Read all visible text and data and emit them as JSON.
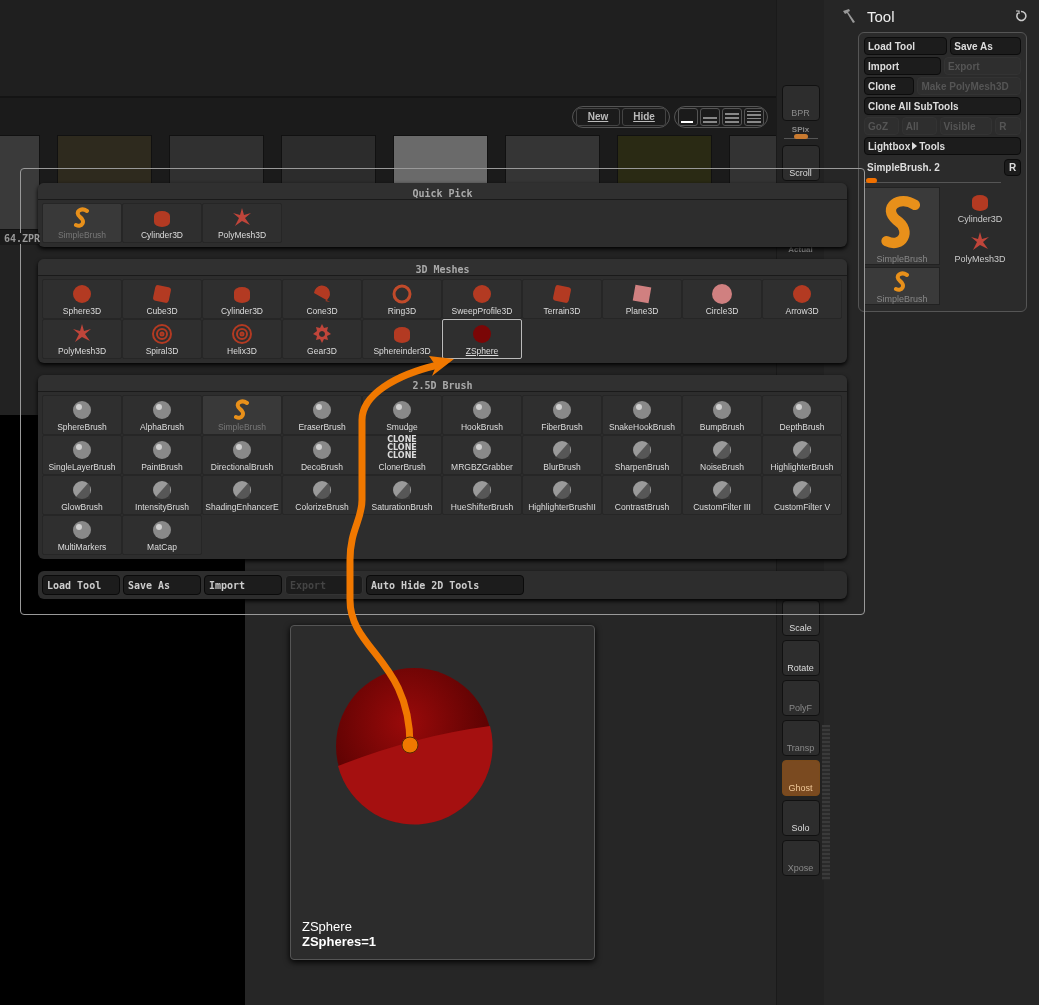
{
  "lightbox": {
    "file_label": "64.ZPR",
    "buttons": [
      {
        "label": "New"
      },
      {
        "label": "Hide"
      }
    ],
    "view_modes": [
      {
        "selected": true
      },
      {
        "selected": false
      },
      {
        "selected": false
      },
      {
        "selected": false
      }
    ]
  },
  "popup": {
    "sections": [
      {
        "title": "Quick Pick",
        "items": [
          {
            "label": "SimpleBrush",
            "kind": "swirl",
            "disabled": true,
            "selected": false
          },
          {
            "label": "Cylinder3D",
            "kind": "cylinder",
            "disabled": false,
            "selected": false
          },
          {
            "label": "PolyMesh3D",
            "kind": "star",
            "disabled": false,
            "selected": false
          }
        ]
      },
      {
        "title": "3D Meshes",
        "items": [
          {
            "label": "Sphere3D",
            "kind": "sphere",
            "disabled": false,
            "selected": false
          },
          {
            "label": "Cube3D",
            "kind": "cube",
            "disabled": false,
            "selected": false
          },
          {
            "label": "Cylinder3D",
            "kind": "cylinder",
            "disabled": false,
            "selected": false
          },
          {
            "label": "Cone3D",
            "kind": "cone",
            "disabled": false,
            "selected": false
          },
          {
            "label": "Ring3D",
            "kind": "ring",
            "disabled": false,
            "selected": false
          },
          {
            "label": "SweepProfile3D",
            "kind": "sphere",
            "disabled": false,
            "selected": false
          },
          {
            "label": "Terrain3D",
            "kind": "cube",
            "disabled": false,
            "selected": false
          },
          {
            "label": "Plane3D",
            "kind": "plate",
            "disabled": false,
            "selected": false
          },
          {
            "label": "Circle3D",
            "kind": "disc",
            "disabled": false,
            "selected": false
          },
          {
            "label": "Arrow3D",
            "kind": "sphere",
            "disabled": false,
            "selected": false
          },
          {
            "label": "PolyMesh3D",
            "kind": "star",
            "disabled": false,
            "selected": false
          },
          {
            "label": "Spiral3D",
            "kind": "spiral",
            "disabled": false,
            "selected": false
          },
          {
            "label": "Helix3D",
            "kind": "spiral",
            "disabled": false,
            "selected": false
          },
          {
            "label": "Gear3D",
            "kind": "gear",
            "disabled": false,
            "selected": false
          },
          {
            "label": "Sphereinder3D",
            "kind": "cylinder",
            "disabled": false,
            "selected": false
          },
          {
            "label": "ZSphere",
            "kind": "zsphere",
            "disabled": false,
            "selected": true
          }
        ]
      },
      {
        "title": "2.5D Brush",
        "items": [
          {
            "label": "SphereBrush",
            "kind": "ball",
            "disabled": false,
            "selected": false
          },
          {
            "label": "AlphaBrush",
            "kind": "ball",
            "disabled": false,
            "selected": false
          },
          {
            "label": "SimpleBrush",
            "kind": "swirl",
            "disabled": true,
            "selected": false
          },
          {
            "label": "EraserBrush",
            "kind": "ball",
            "disabled": false,
            "selected": false
          },
          {
            "label": "Smudge",
            "kind": "ball",
            "disabled": false,
            "selected": false
          },
          {
            "label": "HookBrush",
            "kind": "ball",
            "disabled": false,
            "selected": false
          },
          {
            "label": "FiberBrush",
            "kind": "ball",
            "disabled": false,
            "selected": false
          },
          {
            "label": "SnakeHookBrush",
            "kind": "ball",
            "disabled": false,
            "selected": false
          },
          {
            "label": "BumpBrush",
            "kind": "ball",
            "disabled": false,
            "selected": false
          },
          {
            "label": "DepthBrush",
            "kind": "ball",
            "disabled": false,
            "selected": false
          },
          {
            "label": "SingleLayerBrush",
            "kind": "ball",
            "disabled": false,
            "selected": false
          },
          {
            "label": "PaintBrush",
            "kind": "ball",
            "disabled": false,
            "selected": false
          },
          {
            "label": "DirectionalBrush",
            "kind": "ball",
            "disabled": false,
            "selected": false
          },
          {
            "label": "DecoBrush",
            "kind": "ball",
            "disabled": false,
            "selected": false
          },
          {
            "label": "ClonerBrush",
            "kind": "text-stack",
            "icon_text": [
              "CLONE",
              "CLONE",
              "CLONE"
            ],
            "disabled": false,
            "selected": false
          },
          {
            "label": "MRGBZGrabber",
            "kind": "ball",
            "disabled": false,
            "selected": false
          },
          {
            "label": "BlurBrush",
            "kind": "split-ball",
            "disabled": false,
            "selected": false
          },
          {
            "label": "SharpenBrush",
            "kind": "split-ball",
            "disabled": false,
            "selected": false
          },
          {
            "label": "NoiseBrush",
            "kind": "split-ball",
            "disabled": false,
            "selected": false
          },
          {
            "label": "HighlighterBrush",
            "kind": "split-ball",
            "disabled": false,
            "selected": false
          },
          {
            "label": "GlowBrush",
            "kind": "split-ball",
            "disabled": false,
            "selected": false
          },
          {
            "label": "IntensityBrush",
            "kind": "split-ball",
            "disabled": false,
            "selected": false
          },
          {
            "label": "ShadingEnhancerE",
            "kind": "split-ball",
            "disabled": false,
            "selected": false
          },
          {
            "label": "ColorizeBrush",
            "kind": "split-ball",
            "disabled": false,
            "selected": false
          },
          {
            "label": "SaturationBrush",
            "kind": "split-ball",
            "disabled": false,
            "selected": false
          },
          {
            "label": "HueShifterBrush",
            "kind": "split-ball",
            "disabled": false,
            "selected": false
          },
          {
            "label": "HighlighterBrushII",
            "kind": "split-ball",
            "disabled": false,
            "selected": false
          },
          {
            "label": "ContrastBrush",
            "kind": "split-ball",
            "disabled": false,
            "selected": false
          },
          {
            "label": "CustomFilter  III",
            "kind": "split-ball",
            "disabled": false,
            "selected": false
          },
          {
            "label": "CustomFilter  V",
            "kind": "split-ball",
            "disabled": false,
            "selected": false
          },
          {
            "label": "MultiMarkers",
            "kind": "ball",
            "disabled": false,
            "selected": false
          },
          {
            "label": "MatCap",
            "kind": "ball",
            "disabled": false,
            "selected": false
          }
        ]
      }
    ],
    "buttons": [
      {
        "label": "Load Tool",
        "disabled": false
      },
      {
        "label": "Save As",
        "disabled": false
      },
      {
        "label": "Import",
        "disabled": false
      },
      {
        "label": "Export",
        "disabled": true
      },
      {
        "label": "Auto Hide 2D Tools",
        "disabled": false
      }
    ]
  },
  "preview": {
    "title": "ZSphere",
    "info": "ZSpheres=1"
  },
  "shelf": {
    "top": [
      {
        "label": "BPR",
        "kind": "button",
        "disabled": true
      },
      {
        "label": "SPix",
        "kind": "slider",
        "level": 0.5
      },
      {
        "label": "Scroll",
        "kind": "button",
        "disabled": false
      },
      {
        "label": "Actual",
        "kind": "label"
      }
    ],
    "bottom": [
      {
        "label": "Scale",
        "disabled": false,
        "active": false
      },
      {
        "label": "Rotate",
        "disabled": false,
        "active": false
      },
      {
        "label": "PolyF",
        "disabled": true,
        "active": false
      },
      {
        "label": "Transp",
        "disabled": true,
        "active": false
      },
      {
        "label": "Ghost",
        "disabled": true,
        "active": true
      },
      {
        "label": "Solo",
        "disabled": false,
        "active": false
      },
      {
        "label": "Xpose",
        "disabled": true,
        "active": false
      }
    ]
  },
  "tool_panel": {
    "title": "Tool",
    "rows": [
      [
        {
          "label": "Load Tool",
          "disabled": false
        },
        {
          "label": "Save As",
          "disabled": false
        }
      ],
      [
        {
          "label": "Import",
          "disabled": false
        },
        {
          "label": "Export",
          "disabled": true
        }
      ],
      [
        {
          "label": "Clone",
          "disabled": false
        },
        {
          "label": "Make PolyMesh3D",
          "disabled": true
        }
      ],
      [
        {
          "label": "Clone All SubTools",
          "disabled": false
        }
      ],
      [
        {
          "label": "GoZ",
          "disabled": true
        },
        {
          "label": "All",
          "disabled": true
        },
        {
          "label": "Visible",
          "disabled": true
        },
        {
          "label": "R",
          "disabled": true
        }
      ]
    ],
    "lightbox_link": {
      "label": "Lightbox",
      "target": "Tools"
    },
    "current": {
      "name": "SimpleBrush. 2",
      "level": 0.08,
      "reset": "R"
    },
    "thumbnails": [
      {
        "label": "SimpleBrush",
        "kind": "swirl",
        "large": true,
        "selected": true
      },
      {
        "label": "SimpleBrush",
        "kind": "swirl",
        "large": false,
        "selected": true
      },
      {
        "label": "Cylinder3D",
        "kind": "cylinder",
        "large": false,
        "selected": false
      },
      {
        "label": "PolyMesh3D",
        "kind": "star",
        "large": false,
        "selected": false
      }
    ]
  }
}
